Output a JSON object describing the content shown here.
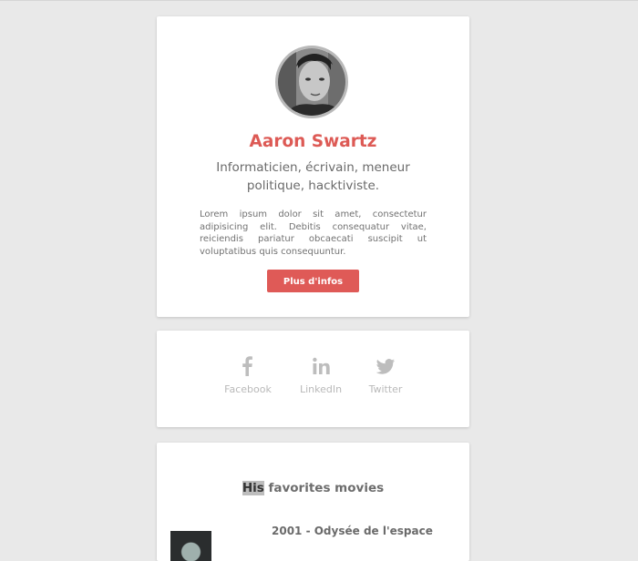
{
  "profile": {
    "name": "Aaron Swartz",
    "tagline": "Informaticien, écrivain, meneur politique, hacktiviste.",
    "bio": "Lorem ipsum dolor sit amet, consectetur adipisicing elit. Debitis consequatur vitae, reiciendis pariatur obcaecati suscipit ut voluptatibus quis consequuntur.",
    "button_label": "Plus d'infos"
  },
  "social": {
    "items": [
      {
        "label": "Facebook",
        "icon": "facebook-icon"
      },
      {
        "label": "LinkedIn",
        "icon": "linkedin-icon"
      },
      {
        "label": "Twitter",
        "icon": "twitter-icon"
      }
    ]
  },
  "movies": {
    "title_highlight": "His",
    "title_rest": " favorites movies",
    "items": [
      {
        "title": "2001 - Odysée de l'espace"
      }
    ]
  },
  "colors": {
    "accent": "#dd5a55",
    "background": "#e9e9e9",
    "muted": "#b9b9b9"
  }
}
